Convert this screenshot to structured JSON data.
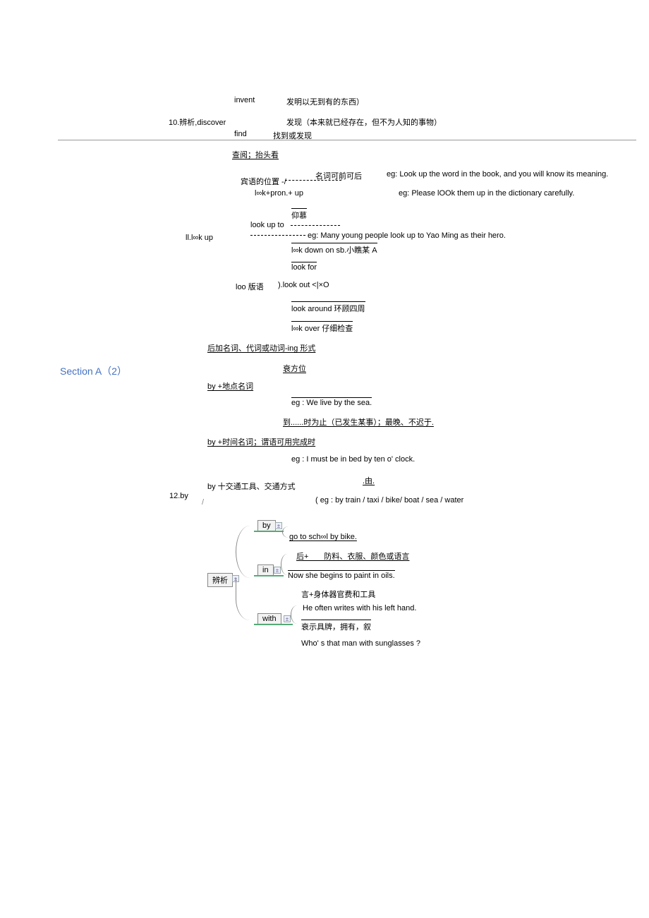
{
  "title": "Section A（2）",
  "row10": {
    "label": "10.辨析,discover",
    "invent": {
      "en": "invent",
      "zh": "发明以无到有的东西）"
    },
    "discover_zh": "发现（本来就已经存在，但不为人知的事物）",
    "find": {
      "en": "find",
      "zh": "找到或发现"
    }
  },
  "row11": {
    "label": "ll.l∞k up",
    "meaning1": "查阅；抬头看",
    "objpos": {
      "label": "宾语的位置 -/",
      "a": "名词可前可后",
      "b": "l∞k+pron.+ up",
      "eg_a": "eg: Look up the word in the book, and you will know its meaning.",
      "eg_b": "eg: Please lOOk them up in the dictionary carefully."
    },
    "lookupto": {
      "label": "look up to",
      "meaning": "仰慕",
      "eg": "eg: Many young people look up to Yao Ming as their hero."
    },
    "lookdown": "l∞k down on sb.小瞧某 A",
    "phrases": {
      "label": "loo 版语",
      "for": "look for",
      "out": ").look out <|×O",
      "around": "look around 环顾四周",
      "over": "l∞k over 仔细检查"
    }
  },
  "row12": {
    "label": "12.by",
    "rule1": "后加名词、代词或动词-ing 形式",
    "place": {
      "meaning": "衰方位",
      "label": "by +地点名词",
      "eg": "eg : We live by the sea."
    },
    "time": {
      "meaning": "到......时为止（已发生某事）；最晚、不迟于.",
      "label": "by +时间名词；谓语可用完成时",
      "eg": "eg : I must be in bed by ten o' clock."
    },
    "transport": {
      "label": "by 十交通工具、交通方式",
      "meaning": ".由.",
      "eg": "( eg : by train / taxi / bike/ boat / sea / water"
    },
    "compare": {
      "root": "辨析",
      "by": {
        "label": "by",
        "eg": "go to sch∞l by bike."
      },
      "in": {
        "label": "in",
        "rule": "后+　　防料、衣服、颜色或语言",
        "eg": "Now she begins to paint in oils."
      },
      "with": {
        "label": "with",
        "rule": "言+身体器官费和工具",
        "eg": "He often writes with his left hand.",
        "rule2": "衰示具牌，拥有，叙",
        "eg2": "Who' s that man with sunglasses ?"
      }
    }
  }
}
